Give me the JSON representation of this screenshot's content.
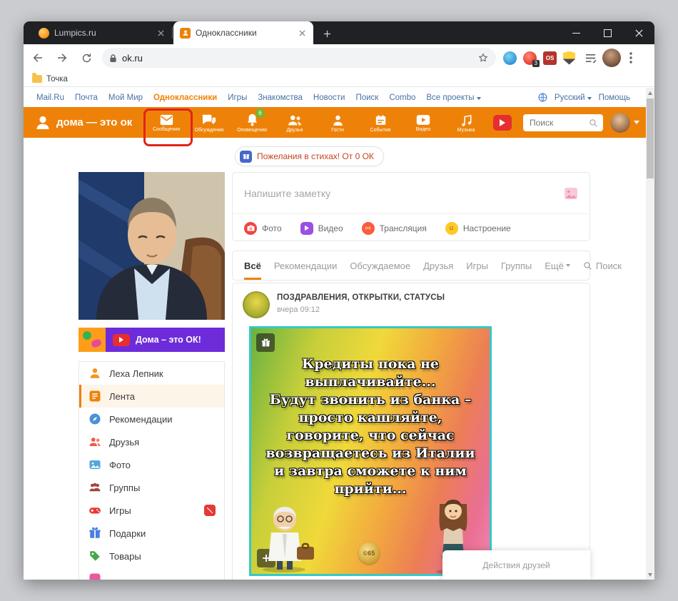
{
  "browser": {
    "tabs": [
      {
        "title": "Lumpics.ru"
      },
      {
        "title": "Одноклассники"
      }
    ],
    "address": "ok.ru",
    "bookmark_folder": "Точка",
    "extension_badge": "3",
    "extension_os_label": "OS"
  },
  "topbar": {
    "links": [
      "Mail.Ru",
      "Почта",
      "Мой Мир",
      "Одноклассники",
      "Игры",
      "Знакомства",
      "Новости",
      "Поиск",
      "Combo",
      "Все проекты"
    ],
    "language": "Русский",
    "help": "Помощь"
  },
  "okheader": {
    "logo_text": "дома — это ок",
    "nav": [
      {
        "label": "Сообщения"
      },
      {
        "label": "Обсуждения"
      },
      {
        "label": "Оповещения",
        "badge": "6"
      },
      {
        "label": "Друзья"
      },
      {
        "label": "Гости"
      },
      {
        "label": "События"
      },
      {
        "label": "Видео"
      },
      {
        "label": "Музыка"
      }
    ],
    "search_placeholder": "Поиск"
  },
  "promo_pill": {
    "text": "Пожелания в стихах! От 0 ОК"
  },
  "sidebar": {
    "video_banner": "Дома – это ОК!",
    "items": [
      {
        "label": "Леха Лепник"
      },
      {
        "label": "Лента"
      },
      {
        "label": "Рекомендации"
      },
      {
        "label": "Друзья"
      },
      {
        "label": "Фото"
      },
      {
        "label": "Группы"
      },
      {
        "label": "Игры"
      },
      {
        "label": "Подарки"
      },
      {
        "label": "Товары"
      }
    ]
  },
  "composer": {
    "placeholder": "Напишите заметку",
    "actions": [
      {
        "label": "Фото"
      },
      {
        "label": "Видео"
      },
      {
        "label": "Трансляция"
      },
      {
        "label": "Настроение"
      }
    ]
  },
  "feed": {
    "tabs": [
      {
        "label": "Всё"
      },
      {
        "label": "Рекомендации"
      },
      {
        "label": "Обсуждаемое"
      },
      {
        "label": "Друзья"
      },
      {
        "label": "Игры"
      },
      {
        "label": "Группы"
      },
      {
        "label": "Ещё"
      }
    ],
    "search_label": "Поиск"
  },
  "post": {
    "group": "ПОЗДРАВЛЕНИЯ, ОТКРЫТКИ, СТАТУСЫ",
    "time": "вчера 09:12",
    "meme_lines": [
      "Кредиты пока не",
      "выплачивайте...",
      "Будут звонить из банка –",
      "просто кашляйте,",
      "говорите, что сейчас",
      "возвращаетесь из Италии",
      "и завтра сможете к ним",
      "прийти..."
    ],
    "watermark": "©65"
  },
  "friends_panel": {
    "title": "Действия друзей"
  }
}
